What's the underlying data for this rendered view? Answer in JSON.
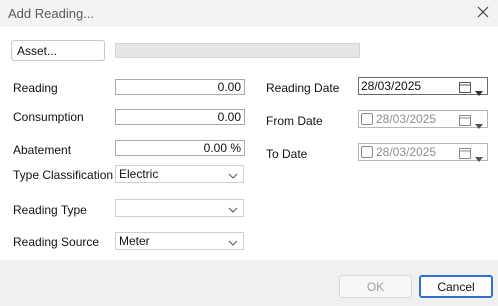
{
  "window": {
    "title": "Add Reading..."
  },
  "asset": {
    "button_label": "Asset...",
    "value": ""
  },
  "fields": {
    "reading": {
      "label": "Reading",
      "value": "0.00"
    },
    "consumption": {
      "label": "Consumption",
      "value": "0.00"
    },
    "abatement": {
      "label": "Abatement",
      "value": "0.00 %"
    },
    "type_classification": {
      "label": "Type Classification",
      "value": "Electric"
    },
    "reading_type": {
      "label": "Reading Type",
      "value": ""
    },
    "reading_source": {
      "label": "Reading Source",
      "value": "Meter"
    }
  },
  "dates": {
    "reading_date": {
      "label": "Reading Date",
      "value": "28/03/2025",
      "enabled": true
    },
    "from_date": {
      "label": "From Date",
      "value": "28/03/2025",
      "enabled": false,
      "checked": false
    },
    "to_date": {
      "label": "To Date",
      "value": "28/03/2025",
      "enabled": false,
      "checked": false
    }
  },
  "buttons": {
    "ok": "OK",
    "cancel": "Cancel"
  },
  "icons": {
    "close": "close-icon",
    "chevron": "chevron-down-icon",
    "calendar": "calendar-icon",
    "dropdown": "dropdown-arrow-icon"
  },
  "colors": {
    "focus_border": "#2f6fcf",
    "disabled_text": "#a0a0a0"
  }
}
